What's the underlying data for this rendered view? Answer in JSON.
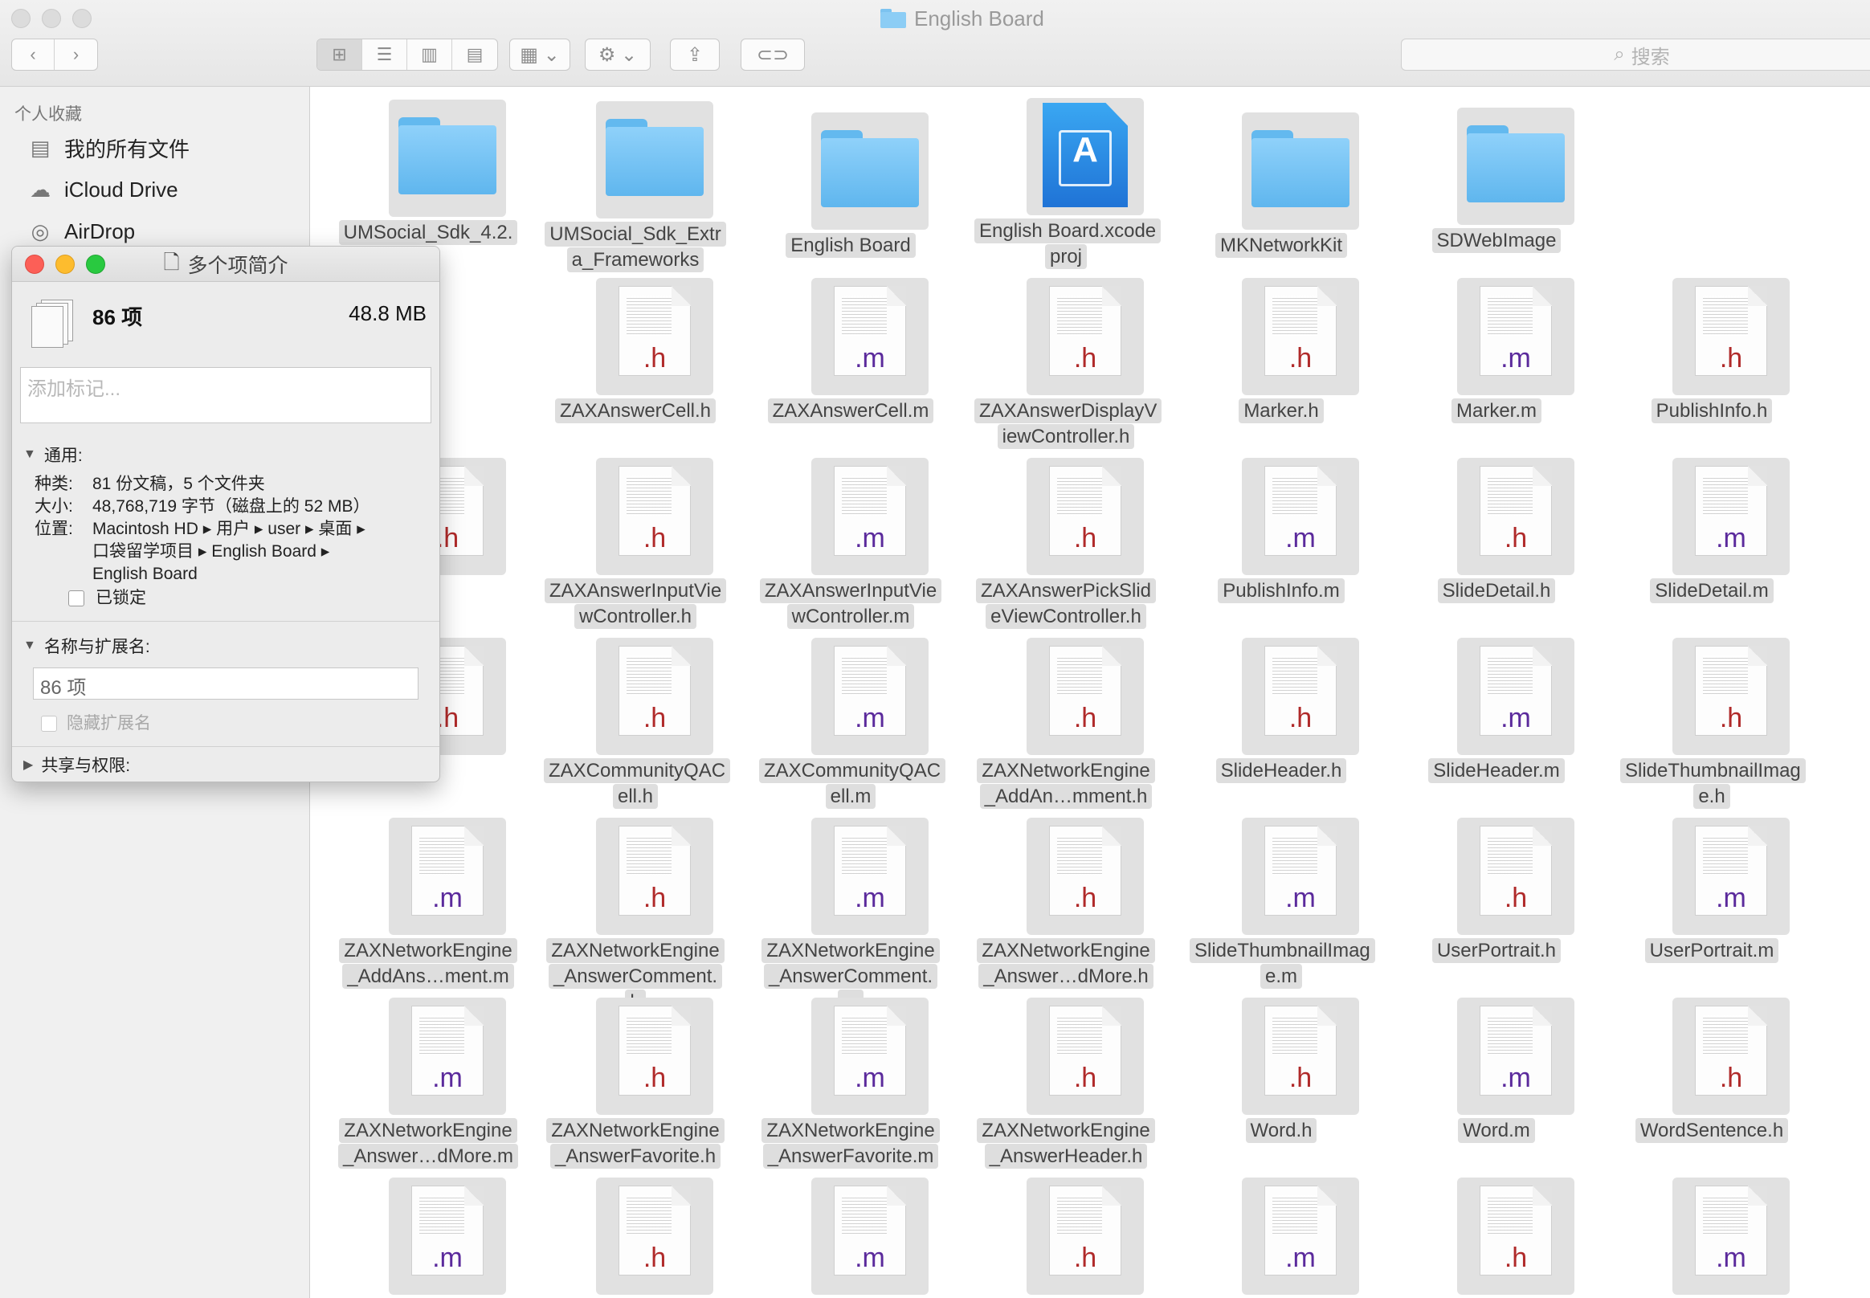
{
  "window": {
    "title": "English Board"
  },
  "toolbar": {
    "back": "‹",
    "forward": "›",
    "view_modes": [
      "⊞",
      "☰",
      "▥",
      "▤"
    ],
    "arrange": "▦ ⌄",
    "action": "⚙ ⌄",
    "share": "⇪",
    "tag": "⊂⊃",
    "search_placeholder": "搜索"
  },
  "sidebar": {
    "header": "个人收藏",
    "items": [
      {
        "label": "我的所有文件",
        "icon": "all-files-icon"
      },
      {
        "label": "iCloud Drive",
        "icon": "cloud-icon"
      },
      {
        "label": "AirDrop",
        "icon": "airdrop-icon"
      }
    ]
  },
  "info_panel": {
    "title": "多个项简介",
    "count": "86 项",
    "size": "48.8 MB",
    "tags_placeholder": "添加标记...",
    "general_header": "通用:",
    "kind_label": "种类:",
    "kind_value": "81 份文稿，5 个文件夹",
    "size_label": "大小:",
    "size_value": "48,768,719 字节（磁盘上的 52 MB）",
    "where_label": "位置:",
    "where_line1": "Macintosh HD ▸ 用户 ▸ user ▸ 桌面 ▸",
    "where_line2": "口袋留学项目 ▸ English Board ▸",
    "where_line3": "English Board",
    "locked_label": "已锁定",
    "name_header": "名称与扩展名:",
    "name_value": "86 项",
    "hide_ext_label": "隐藏扩展名",
    "sharing_header": "共享与权限:"
  },
  "files": [
    {
      "name": "UMSocial_Sdk_4.2.",
      "type": "folder"
    },
    {
      "name": "UMSocial_Sdk_Extra_Frameworks",
      "type": "folder"
    },
    {
      "name": "English Board",
      "type": "folder"
    },
    {
      "name": "English Board.xcodeproj",
      "type": "xcodeproj"
    },
    {
      "name": "MKNetworkKit",
      "type": "folder"
    },
    {
      "name": "SDWebImage",
      "type": "folder"
    },
    {
      "name": "",
      "type": "blank"
    },
    {
      "name": "",
      "type": "hidden"
    },
    {
      "name": "ZAXAnswerCell.h",
      "type": "h"
    },
    {
      "name": "ZAXAnswerCell.m",
      "type": "m"
    },
    {
      "name": "ZAXAnswerDisplayViewController.h",
      "type": "h"
    },
    {
      "name": "Marker.h",
      "type": "h"
    },
    {
      "name": "Marker.m",
      "type": "m"
    },
    {
      "name": "PublishInfo.h",
      "type": "h"
    },
    {
      "name": "",
      "type": "h"
    },
    {
      "name": "ZAXAnswerInputViewController.h",
      "type": "h"
    },
    {
      "name": "ZAXAnswerInputViewController.m",
      "type": "m"
    },
    {
      "name": "ZAXAnswerPickSlideViewController.h",
      "type": "h"
    },
    {
      "name": "PublishInfo.m",
      "type": "m"
    },
    {
      "name": "SlideDetail.h",
      "type": "h"
    },
    {
      "name": "SlideDetail.m",
      "type": "m"
    },
    {
      "name": "",
      "type": "h"
    },
    {
      "name": "ZAXCommunityQACell.h",
      "type": "h"
    },
    {
      "name": "ZAXCommunityQACell.m",
      "type": "m"
    },
    {
      "name": "ZAXNetworkEngine_AddAn…mment.h",
      "type": "h"
    },
    {
      "name": "SlideHeader.h",
      "type": "h"
    },
    {
      "name": "SlideHeader.m",
      "type": "m"
    },
    {
      "name": "SlideThumbnailImage.h",
      "type": "h"
    },
    {
      "name": "ZAXNetworkEngine_AddAns…ment.m",
      "type": "m"
    },
    {
      "name": "ZAXNetworkEngine_AnswerComment.h",
      "type": "h"
    },
    {
      "name": "ZAXNetworkEngine_AnswerComment.m",
      "type": "m"
    },
    {
      "name": "ZAXNetworkEngine_Answer…dMore.h",
      "type": "h"
    },
    {
      "name": "SlideThumbnailImage.m",
      "type": "m"
    },
    {
      "name": "UserPortrait.h",
      "type": "h"
    },
    {
      "name": "UserPortrait.m",
      "type": "m"
    },
    {
      "name": "ZAXNetworkEngine_Answer…dMore.m",
      "type": "m"
    },
    {
      "name": "ZAXNetworkEngine_AnswerFavorite.h",
      "type": "h"
    },
    {
      "name": "ZAXNetworkEngine_AnswerFavorite.m",
      "type": "m"
    },
    {
      "name": "ZAXNetworkEngine_AnswerHeader.h",
      "type": "h"
    },
    {
      "name": "Word.h",
      "type": "h"
    },
    {
      "name": "Word.m",
      "type": "m"
    },
    {
      "name": "WordSentence.h",
      "type": "h"
    },
    {
      "name": "",
      "type": "m"
    },
    {
      "name": "",
      "type": "h"
    },
    {
      "name": "",
      "type": "m"
    },
    {
      "name": "",
      "type": "h"
    },
    {
      "name": "",
      "type": "m"
    },
    {
      "name": "",
      "type": "h"
    },
    {
      "name": "",
      "type": "m"
    }
  ]
}
